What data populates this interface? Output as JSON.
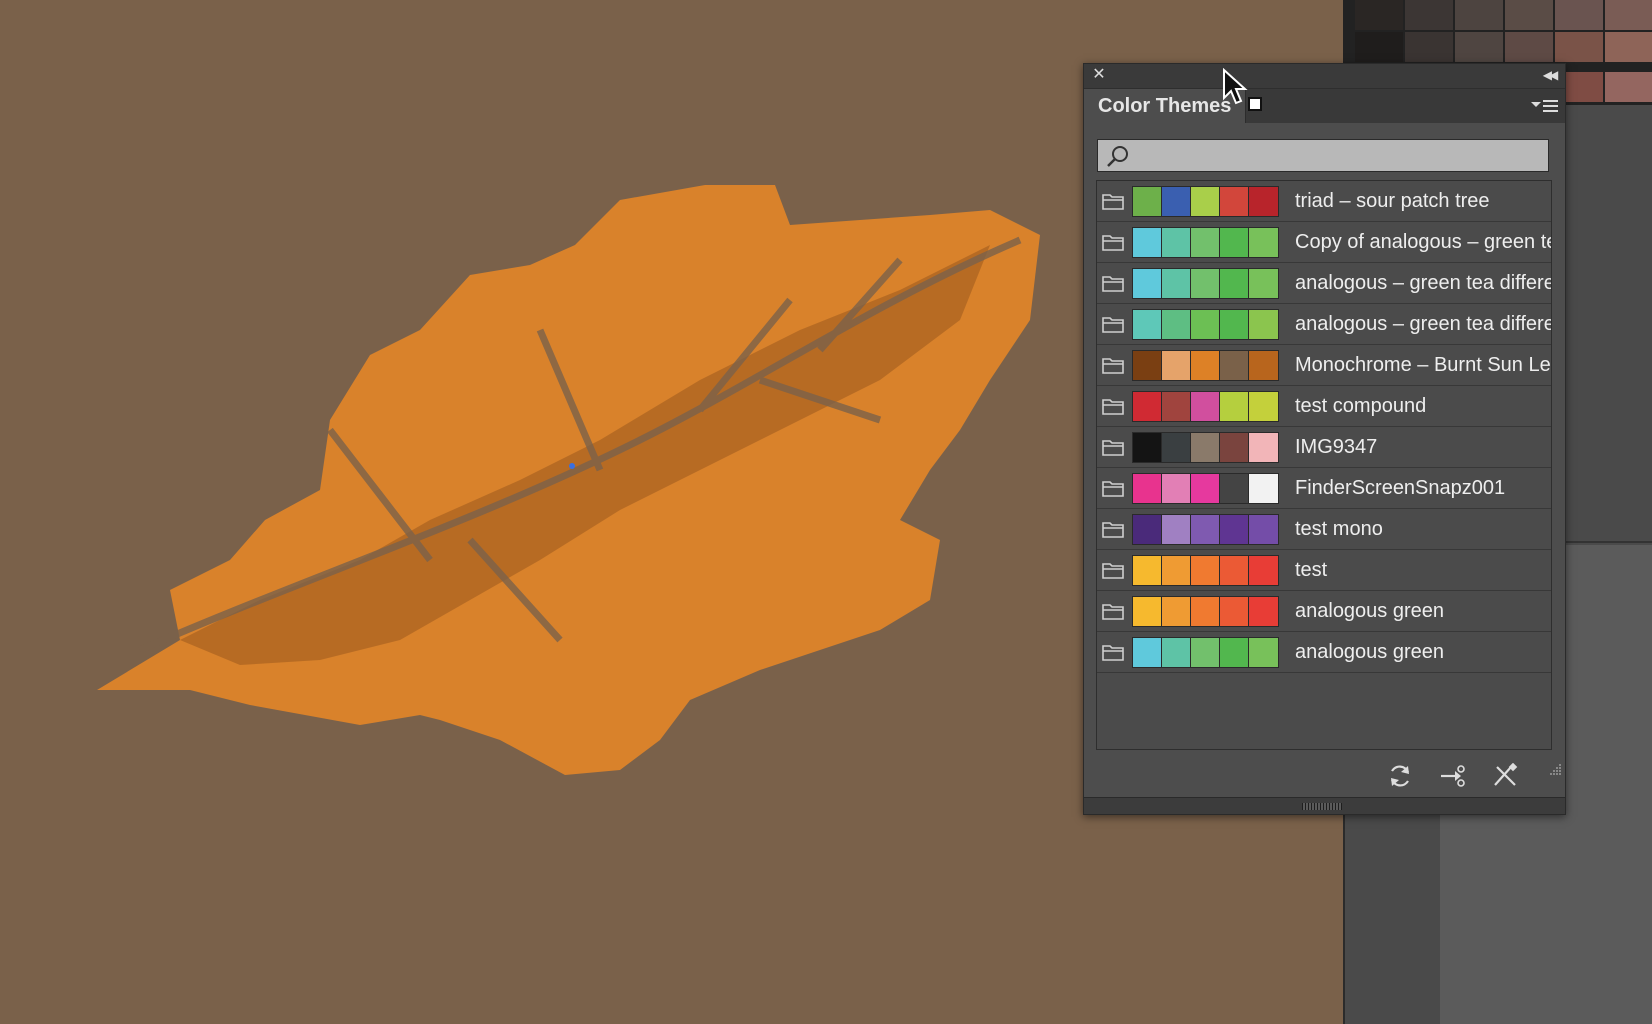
{
  "panel": {
    "title": "Color Themes",
    "close_icon": "close-icon",
    "collapse_icon": "double-chevron-left-icon",
    "menu_icon": "panel-menu-icon",
    "search": {
      "value": "",
      "placeholder": ""
    },
    "themes": [
      {
        "name": "triad – sour patch tree",
        "colors": [
          "#6db04a",
          "#3a5fb0",
          "#a9cf4a",
          "#d2463b",
          "#b8242b"
        ]
      },
      {
        "name": "Copy of analogous – green tea difference",
        "colors": [
          "#5fc9dc",
          "#5ec3a6",
          "#72c06c",
          "#52b74e",
          "#78c15a"
        ]
      },
      {
        "name": "analogous – green tea difference",
        "colors": [
          "#5fc9dc",
          "#5ec3a6",
          "#72c06c",
          "#52b74e",
          "#78c15a"
        ]
      },
      {
        "name": "analogous – green tea difference",
        "colors": [
          "#5ec8b8",
          "#5ebe83",
          "#6cbf54",
          "#52b74e",
          "#8bc54e"
        ]
      },
      {
        "name": "Monochrome – Burnt Sun Leaf",
        "colors": [
          "#7a3f12",
          "#e5a36a",
          "#dd8126",
          "#7a6149",
          "#b8651d"
        ]
      },
      {
        "name": "test compound",
        "colors": [
          "#d02a33",
          "#a0443e",
          "#d14f9e",
          "#b5cf3e",
          "#c4d03b"
        ]
      },
      {
        "name": "IMG9347",
        "colors": [
          "#141414",
          "#3a3f41",
          "#8a7a6a",
          "#7a443e",
          "#f2b5b8"
        ]
      },
      {
        "name": "FinderScreenSnapz001",
        "colors": [
          "#e8338e",
          "#e27fb5",
          "#e6399e",
          "#444444",
          "#f2f2f2"
        ]
      },
      {
        "name": "test mono",
        "colors": [
          "#4a2a7a",
          "#a080c2",
          "#7f5ab0",
          "#5f3592",
          "#744da8"
        ]
      },
      {
        "name": "test",
        "colors": [
          "#f6b92e",
          "#ef9b33",
          "#f07a30",
          "#eb5a35",
          "#e83d36"
        ]
      },
      {
        "name": "analogous green",
        "colors": [
          "#f6b92e",
          "#ef9b33",
          "#f07a30",
          "#eb5a35",
          "#e83d36"
        ]
      },
      {
        "name": "analogous green",
        "colors": [
          "#5fc9dc",
          "#5ec3a6",
          "#72c06c",
          "#52b74e",
          "#78c15a"
        ]
      }
    ],
    "bottom_icons": [
      "refresh-icon",
      "add-to-swatches-icon",
      "delete-theme-icon"
    ]
  },
  "colors": {
    "canvas": "#7a614a",
    "leaf": "#d9822b",
    "panel_bg": "#4d4d4d",
    "text": "#eeeeee"
  }
}
